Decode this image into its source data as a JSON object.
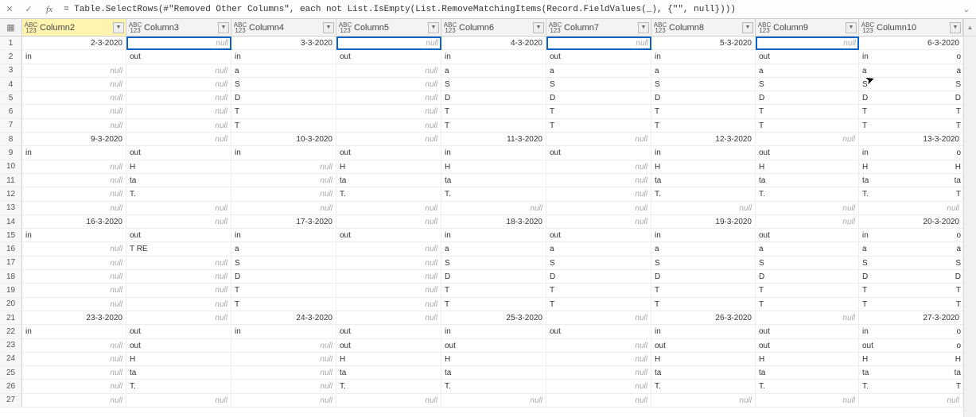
{
  "formula_bar": {
    "formula": "= Table.SelectRows(#\"Removed Other Columns\", each not List.IsEmpty(List.RemoveMatchingItems(Record.FieldValues(_), {\"\", null})))"
  },
  "columns": [
    {
      "name": "Column2",
      "selected": true
    },
    {
      "name": "Column3"
    },
    {
      "name": "Column4"
    },
    {
      "name": "Column5"
    },
    {
      "name": "Column6"
    },
    {
      "name": "Column7"
    },
    {
      "name": "Column8"
    },
    {
      "name": "Column9"
    },
    {
      "name": "Column10"
    }
  ],
  "type_icon": {
    "top": "ABC",
    "bot": "123"
  },
  "null_text": "null",
  "row_numbers": [
    1,
    2,
    3,
    4,
    5,
    6,
    7,
    8,
    9,
    10,
    11,
    12,
    13,
    14,
    15,
    16,
    17,
    18,
    19,
    20,
    21,
    22,
    23,
    24,
    25,
    26,
    27
  ],
  "highlight_cells": [
    [
      1,
      2
    ],
    [
      1,
      4
    ],
    [
      1,
      6
    ],
    [
      1,
      8
    ]
  ],
  "rows": [
    [
      {
        "v": "2-3-2020",
        "t": "d"
      },
      {
        "v": null,
        "hl": true
      },
      {
        "v": "3-3-2020",
        "t": "d"
      },
      {
        "v": null,
        "hl": true
      },
      {
        "v": "4-3-2020",
        "t": "d"
      },
      {
        "v": null,
        "hl": true
      },
      {
        "v": "5-3-2020",
        "t": "d"
      },
      {
        "v": null,
        "hl": true
      },
      {
        "v": "6-3-2020",
        "t": "d"
      }
    ],
    [
      {
        "v": "in"
      },
      {
        "v": "out"
      },
      {
        "v": "in"
      },
      {
        "v": "out"
      },
      {
        "v": "in"
      },
      {
        "v": "out"
      },
      {
        "v": "in"
      },
      {
        "v": "out"
      },
      {
        "v": "in",
        "tail": "o"
      }
    ],
    [
      {
        "v": null
      },
      {
        "v": null
      },
      {
        "v": "a"
      },
      {
        "v": null
      },
      {
        "v": "a"
      },
      {
        "v": "a"
      },
      {
        "v": "a"
      },
      {
        "v": "a"
      },
      {
        "v": "a",
        "tail": "a"
      }
    ],
    [
      {
        "v": null
      },
      {
        "v": null
      },
      {
        "v": "S"
      },
      {
        "v": null
      },
      {
        "v": "S"
      },
      {
        "v": "S"
      },
      {
        "v": "S"
      },
      {
        "v": "S"
      },
      {
        "v": "S",
        "tail": "S"
      }
    ],
    [
      {
        "v": null
      },
      {
        "v": null
      },
      {
        "v": "D"
      },
      {
        "v": null
      },
      {
        "v": "D"
      },
      {
        "v": "D"
      },
      {
        "v": "D"
      },
      {
        "v": "D"
      },
      {
        "v": "D",
        "tail": "D"
      }
    ],
    [
      {
        "v": null
      },
      {
        "v": null
      },
      {
        "v": "T"
      },
      {
        "v": null
      },
      {
        "v": "T"
      },
      {
        "v": "T"
      },
      {
        "v": "T"
      },
      {
        "v": "T"
      },
      {
        "v": "T",
        "tail": "T"
      }
    ],
    [
      {
        "v": null
      },
      {
        "v": null
      },
      {
        "v": "T"
      },
      {
        "v": null
      },
      {
        "v": "T"
      },
      {
        "v": "T"
      },
      {
        "v": "T"
      },
      {
        "v": "T"
      },
      {
        "v": "T",
        "tail": "T"
      }
    ],
    [
      {
        "v": "9-3-2020",
        "t": "d"
      },
      {
        "v": null
      },
      {
        "v": "10-3-2020",
        "t": "d"
      },
      {
        "v": null
      },
      {
        "v": "11-3-2020",
        "t": "d"
      },
      {
        "v": null
      },
      {
        "v": "12-3-2020",
        "t": "d"
      },
      {
        "v": null
      },
      {
        "v": "13-3-2020",
        "t": "d"
      }
    ],
    [
      {
        "v": "in"
      },
      {
        "v": "out"
      },
      {
        "v": "in"
      },
      {
        "v": "out"
      },
      {
        "v": "in"
      },
      {
        "v": "out"
      },
      {
        "v": "in"
      },
      {
        "v": "out"
      },
      {
        "v": "in",
        "tail": "o"
      }
    ],
    [
      {
        "v": null
      },
      {
        "v": "H"
      },
      {
        "v": null
      },
      {
        "v": "H"
      },
      {
        "v": "H"
      },
      {
        "v": null
      },
      {
        "v": "H"
      },
      {
        "v": "H"
      },
      {
        "v": "H",
        "tail": "H"
      }
    ],
    [
      {
        "v": null
      },
      {
        "v": "ta"
      },
      {
        "v": null
      },
      {
        "v": "ta"
      },
      {
        "v": "ta"
      },
      {
        "v": null
      },
      {
        "v": "ta"
      },
      {
        "v": "ta"
      },
      {
        "v": "ta",
        "tail": "ta"
      }
    ],
    [
      {
        "v": null
      },
      {
        "v": "T."
      },
      {
        "v": null
      },
      {
        "v": "T."
      },
      {
        "v": "T."
      },
      {
        "v": null
      },
      {
        "v": "T."
      },
      {
        "v": "T."
      },
      {
        "v": "T.",
        "tail": "T"
      }
    ],
    [
      {
        "v": null
      },
      {
        "v": null
      },
      {
        "v": null
      },
      {
        "v": null
      },
      {
        "v": null
      },
      {
        "v": null
      },
      {
        "v": null
      },
      {
        "v": null
      },
      {
        "v": null
      }
    ],
    [
      {
        "v": "16-3-2020",
        "t": "d"
      },
      {
        "v": null
      },
      {
        "v": "17-3-2020",
        "t": "d"
      },
      {
        "v": null
      },
      {
        "v": "18-3-2020",
        "t": "d"
      },
      {
        "v": null
      },
      {
        "v": "19-3-2020",
        "t": "d"
      },
      {
        "v": null
      },
      {
        "v": "20-3-2020",
        "t": "d"
      }
    ],
    [
      {
        "v": "in"
      },
      {
        "v": "out"
      },
      {
        "v": "in"
      },
      {
        "v": "out"
      },
      {
        "v": "in"
      },
      {
        "v": "out"
      },
      {
        "v": "in"
      },
      {
        "v": "out"
      },
      {
        "v": "in",
        "tail": "o"
      }
    ],
    [
      {
        "v": null
      },
      {
        "v": "T RE"
      },
      {
        "v": "a"
      },
      {
        "v": null
      },
      {
        "v": "a"
      },
      {
        "v": "a"
      },
      {
        "v": "a"
      },
      {
        "v": "a"
      },
      {
        "v": "a",
        "tail": "a"
      }
    ],
    [
      {
        "v": null
      },
      {
        "v": null
      },
      {
        "v": "S"
      },
      {
        "v": null
      },
      {
        "v": "S"
      },
      {
        "v": "S"
      },
      {
        "v": "S"
      },
      {
        "v": "S"
      },
      {
        "v": "S",
        "tail": "S"
      }
    ],
    [
      {
        "v": null
      },
      {
        "v": null
      },
      {
        "v": "D"
      },
      {
        "v": null
      },
      {
        "v": "D"
      },
      {
        "v": "D"
      },
      {
        "v": "D"
      },
      {
        "v": "D"
      },
      {
        "v": "D",
        "tail": "D"
      }
    ],
    [
      {
        "v": null
      },
      {
        "v": null
      },
      {
        "v": "T"
      },
      {
        "v": null
      },
      {
        "v": "T"
      },
      {
        "v": "T"
      },
      {
        "v": "T"
      },
      {
        "v": "T"
      },
      {
        "v": "T",
        "tail": "T"
      }
    ],
    [
      {
        "v": null
      },
      {
        "v": null
      },
      {
        "v": "T"
      },
      {
        "v": null
      },
      {
        "v": "T"
      },
      {
        "v": "T"
      },
      {
        "v": "T"
      },
      {
        "v": "T"
      },
      {
        "v": "T",
        "tail": "T"
      }
    ],
    [
      {
        "v": "23-3-2020",
        "t": "d"
      },
      {
        "v": null
      },
      {
        "v": "24-3-2020",
        "t": "d"
      },
      {
        "v": null
      },
      {
        "v": "25-3-2020",
        "t": "d"
      },
      {
        "v": null
      },
      {
        "v": "26-3-2020",
        "t": "d"
      },
      {
        "v": null
      },
      {
        "v": "27-3-2020",
        "t": "d"
      }
    ],
    [
      {
        "v": "in"
      },
      {
        "v": "out"
      },
      {
        "v": "in"
      },
      {
        "v": "out"
      },
      {
        "v": "in"
      },
      {
        "v": "out"
      },
      {
        "v": "in"
      },
      {
        "v": "out"
      },
      {
        "v": "in",
        "tail": "o"
      }
    ],
    [
      {
        "v": null
      },
      {
        "v": "out"
      },
      {
        "v": null
      },
      {
        "v": "out"
      },
      {
        "v": "out"
      },
      {
        "v": null
      },
      {
        "v": "out"
      },
      {
        "v": "out"
      },
      {
        "v": "out",
        "tail": "o"
      }
    ],
    [
      {
        "v": null
      },
      {
        "v": "H"
      },
      {
        "v": null
      },
      {
        "v": "H"
      },
      {
        "v": "H"
      },
      {
        "v": null
      },
      {
        "v": "H"
      },
      {
        "v": "H"
      },
      {
        "v": "H",
        "tail": "H"
      }
    ],
    [
      {
        "v": null
      },
      {
        "v": "ta"
      },
      {
        "v": null
      },
      {
        "v": "ta"
      },
      {
        "v": "ta"
      },
      {
        "v": null
      },
      {
        "v": "ta"
      },
      {
        "v": "ta"
      },
      {
        "v": "ta",
        "tail": "ta"
      }
    ],
    [
      {
        "v": null
      },
      {
        "v": "T."
      },
      {
        "v": null
      },
      {
        "v": "T."
      },
      {
        "v": "T."
      },
      {
        "v": null
      },
      {
        "v": "T."
      },
      {
        "v": "T."
      },
      {
        "v": "T.",
        "tail": "T"
      }
    ],
    [
      {
        "v": null
      },
      {
        "v": null
      },
      {
        "v": null
      },
      {
        "v": null
      },
      {
        "v": null
      },
      {
        "v": null
      },
      {
        "v": null
      },
      {
        "v": null
      },
      {
        "v": null
      }
    ]
  ]
}
